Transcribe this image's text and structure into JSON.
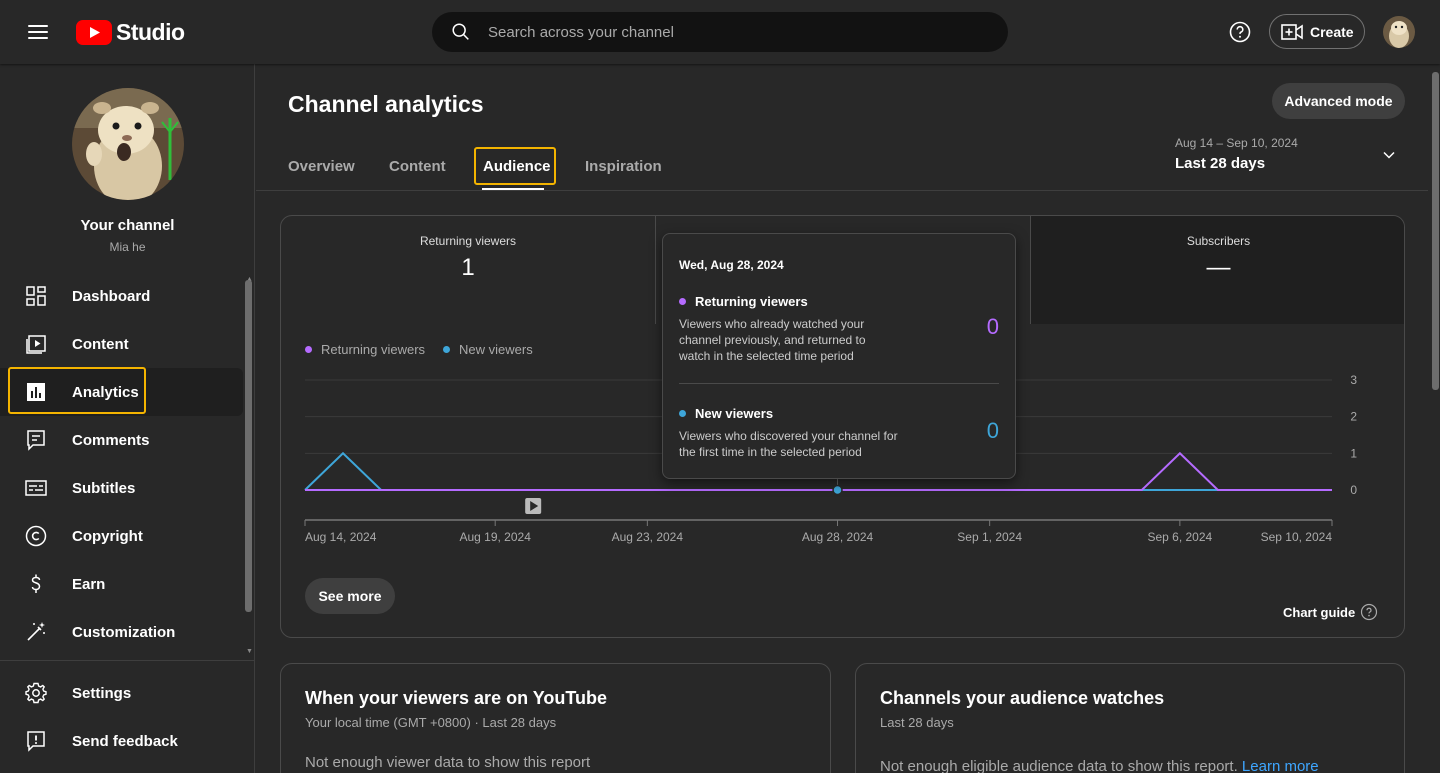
{
  "header": {
    "logo_text": "Studio",
    "search_placeholder": "Search across your channel",
    "create_label": "Create"
  },
  "sidebar": {
    "channel_title": "Your channel",
    "channel_name": "Mia he",
    "items": [
      {
        "label": "Dashboard",
        "icon": "dashboard-icon"
      },
      {
        "label": "Content",
        "icon": "content-icon"
      },
      {
        "label": "Analytics",
        "icon": "analytics-icon",
        "active": true
      },
      {
        "label": "Comments",
        "icon": "comments-icon"
      },
      {
        "label": "Subtitles",
        "icon": "subtitles-icon"
      },
      {
        "label": "Copyright",
        "icon": "copyright-icon"
      },
      {
        "label": "Earn",
        "icon": "earn-icon"
      },
      {
        "label": "Customization",
        "icon": "customization-icon"
      }
    ],
    "bottom_items": [
      {
        "label": "Settings",
        "icon": "gear-icon"
      },
      {
        "label": "Send feedback",
        "icon": "feedback-icon"
      }
    ]
  },
  "main": {
    "title": "Channel analytics",
    "advanced_mode": "Advanced mode",
    "tabs": [
      {
        "label": "Overview"
      },
      {
        "label": "Content"
      },
      {
        "label": "Audience",
        "active": true
      },
      {
        "label": "Inspiration"
      }
    ],
    "date_range": {
      "range": "Aug 14 – Sep 10, 2024",
      "label": "Last 28 days"
    },
    "metrics": [
      {
        "label": "Returning viewers",
        "value": "1"
      },
      {
        "label": "",
        "value": ""
      },
      {
        "label": "Subscribers",
        "value": "—"
      }
    ],
    "legend": [
      "Returning viewers",
      "New viewers"
    ],
    "see_more": "See more",
    "chart_guide": "Chart guide",
    "tooltip": {
      "date": "Wed, Aug 28, 2024",
      "returning_label": "Returning viewers",
      "returning_desc": "Viewers who already watched your channel previously, and returned to watch in the selected time period",
      "returning_value": "0",
      "new_label": "New viewers",
      "new_desc": "Viewers who discovered your channel for the first time in the selected period",
      "new_value": "0"
    },
    "card_viewers": {
      "title": "When your viewers are on YouTube",
      "sub": "Your local time (GMT +0800) · Last 28 days",
      "body": "Not enough viewer data to show this report"
    },
    "card_channels": {
      "title": "Channels your audience watches",
      "sub": "Last 28 days",
      "body": "Not enough eligible audience data to show this report.",
      "link": "Learn more"
    }
  },
  "chart_data": {
    "type": "line",
    "x": [
      "Aug 14, 2024",
      "Aug 15, 2024",
      "Aug 16, 2024",
      "Aug 17, 2024",
      "Aug 18, 2024",
      "Aug 19, 2024",
      "Aug 20, 2024",
      "Aug 21, 2024",
      "Aug 22, 2024",
      "Aug 23, 2024",
      "Aug 24, 2024",
      "Aug 25, 2024",
      "Aug 26, 2024",
      "Aug 27, 2024",
      "Aug 28, 2024",
      "Aug 29, 2024",
      "Aug 30, 2024",
      "Aug 31, 2024",
      "Sep 1, 2024",
      "Sep 2, 2024",
      "Sep 3, 2024",
      "Sep 4, 2024",
      "Sep 5, 2024",
      "Sep 6, 2024",
      "Sep 7, 2024",
      "Sep 8, 2024",
      "Sep 9, 2024",
      "Sep 10, 2024"
    ],
    "x_tick_labels": [
      "Aug 14, 2024",
      "Aug 19, 2024",
      "Aug 23, 2024",
      "Aug 28, 2024",
      "Sep 1, 2024",
      "Sep 6, 2024",
      "Sep 10, 2024"
    ],
    "series": [
      {
        "name": "Returning viewers",
        "color": "#b56bff",
        "values": [
          0,
          0,
          0,
          0,
          0,
          0,
          0,
          0,
          0,
          0,
          0,
          0,
          0,
          0,
          0,
          0,
          0,
          0,
          0,
          0,
          0,
          0,
          0,
          1,
          0,
          0,
          0,
          0
        ]
      },
      {
        "name": "New viewers",
        "color": "#3ea6d9",
        "values": [
          0,
          1,
          0,
          0,
          0,
          0,
          0,
          0,
          0,
          0,
          0,
          0,
          0,
          0,
          0,
          0,
          0,
          0,
          0,
          0,
          0,
          0,
          0,
          0,
          0,
          0,
          0,
          0
        ]
      }
    ],
    "ylim": [
      0,
      3
    ],
    "y_ticks": [
      0,
      1,
      2,
      3
    ],
    "grid": true,
    "legend": "top-left",
    "highlight_index": 14
  }
}
